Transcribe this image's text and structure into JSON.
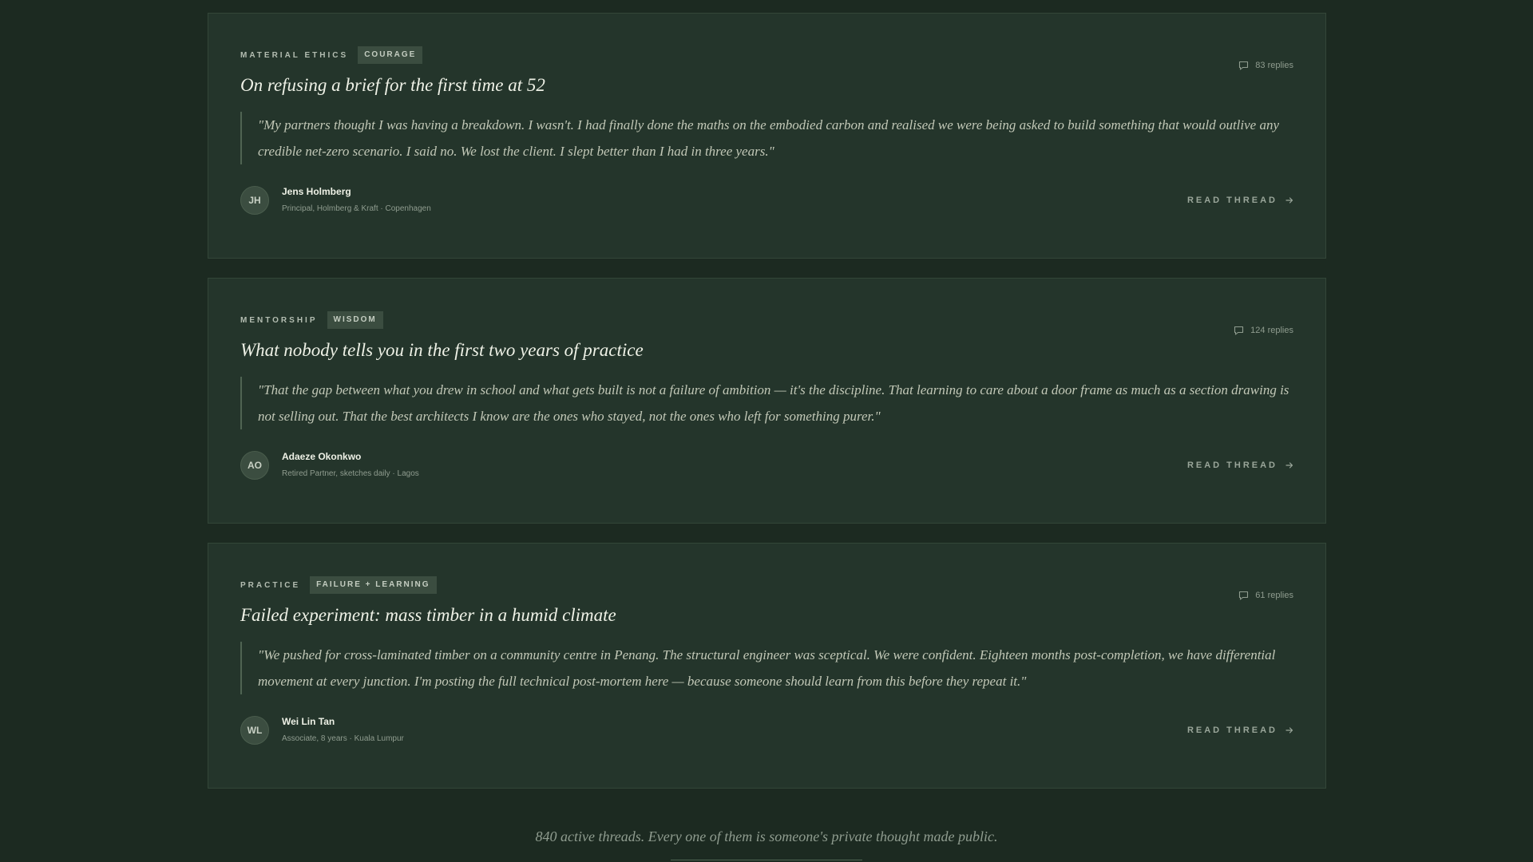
{
  "threads": [
    {
      "category": "MATERIAL ETHICS",
      "tag": "COURAGE",
      "replies": "83 replies",
      "title": "On refusing a brief for the first time at 52",
      "quote": "\"My partners thought I was having a breakdown. I wasn't. I had finally done the maths on the embodied carbon and realised we were being asked to build something that would outlive any credible net-zero scenario. I said no. We lost the client. I slept better than I had in three years.\"",
      "author": {
        "initials": "JH",
        "name": "Jens Holmberg",
        "role": "Principal, Holmberg & Kraft · Copenhagen"
      },
      "cta": "READ THREAD"
    },
    {
      "category": "MENTORSHIP",
      "tag": "WISDOM",
      "replies": "124 replies",
      "title": "What nobody tells you in the first two years of practice",
      "quote": "\"That the gap between what you drew in school and what gets built is not a failure of ambition — it's the discipline. That learning to care about a door frame as much as a section drawing is not selling out. That the best architects I know are the ones who stayed, not the ones who left for something purer.\"",
      "author": {
        "initials": "AO",
        "name": "Adaeze Okonkwo",
        "role": "Retired Partner, sketches daily · Lagos"
      },
      "cta": "READ THREAD"
    },
    {
      "category": "PRACTICE",
      "tag": "FAILURE + LEARNING",
      "replies": "61 replies",
      "title": "Failed experiment: mass timber in a humid climate",
      "quote": "\"We pushed for cross-laminated timber on a community centre in Penang. The structural engineer was sceptical. We were confident. Eighteen months post-completion, we have differential movement at every junction. I'm posting the full technical post-mortem here — because someone should learn from this before they repeat it.\"",
      "author": {
        "initials": "WL",
        "name": "Wei Lin Tan",
        "role": "Associate, 8 years · Kuala Lumpur"
      },
      "cta": "READ THREAD"
    }
  ],
  "footer": {
    "text": "840 active threads. Every one of them is someone's private thought made public."
  },
  "icons": {
    "replies": "speech-bubble-icon",
    "cta": "arrow-right-icon"
  },
  "colors": {
    "background": "#1c2a21",
    "card": "#24352b",
    "title": "#eef1e6",
    "tag": "#3b4d40"
  }
}
